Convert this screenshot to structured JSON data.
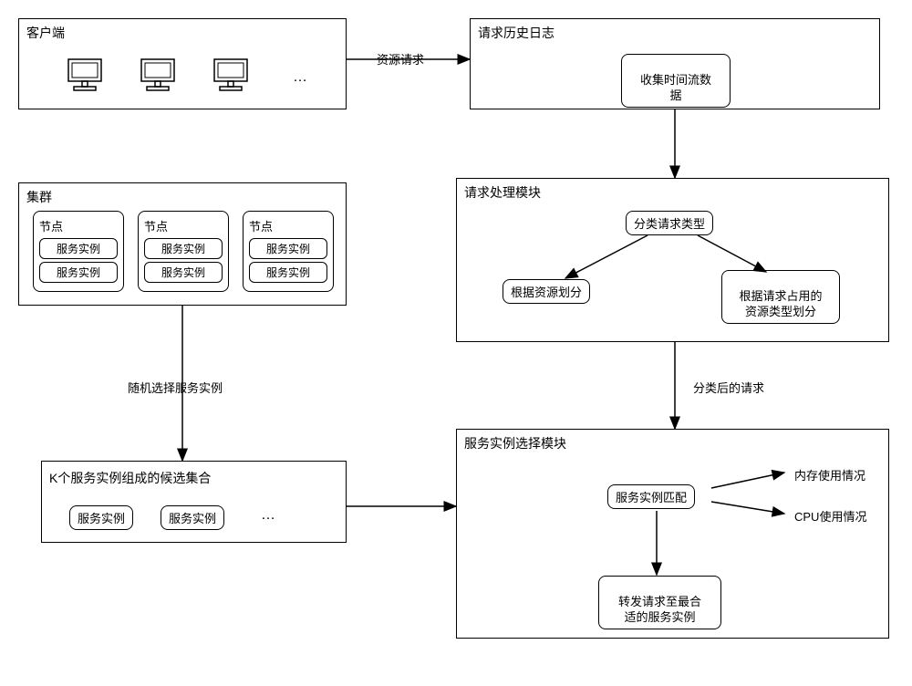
{
  "client": {
    "title": "客户端",
    "ellipsis": "…"
  },
  "arrow_labels": {
    "resource_request": "资源请求",
    "classified_request": "分类后的请求",
    "random_select": "随机选择服务实例"
  },
  "history_log": {
    "title": "请求历史日志",
    "collect_time": "收集时间流数\n据"
  },
  "cluster": {
    "title": "集群",
    "node_label": "节点",
    "instance_label": "服务实例"
  },
  "request_processing": {
    "title": "请求处理模块",
    "classify": "分类请求类型",
    "by_resource": "根据资源划分",
    "by_request_type": "根据请求占用的\n资源类型划分"
  },
  "candidate_set": {
    "title": "K个服务实例组成的候选集合",
    "instance_label": "服务实例",
    "ellipsis": "…"
  },
  "service_selection": {
    "title": "服务实例选择模块",
    "match": "服务实例匹配",
    "memory_usage": "内存使用情况",
    "cpu_usage": "CPU使用情况",
    "forward": "转发请求至最合\n适的服务实例"
  }
}
